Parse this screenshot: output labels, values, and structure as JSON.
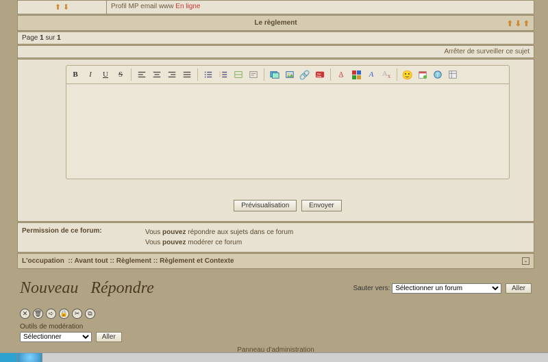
{
  "profile_row": {
    "links": "Profil MP email www",
    "status": "En ligne"
  },
  "section_title": "Le règlement",
  "pagination": {
    "label": "Page",
    "current": "1",
    "sep": "sur",
    "total": "1"
  },
  "stop_watching": "Arrêter de surveiller ce sujet",
  "editor": {
    "preview_btn": "Prévisualisation",
    "submit_btn": "Envoyer"
  },
  "permissions": {
    "label": "Permission de ce forum:",
    "line1_a": "Vous",
    "line1_b": "pouvez",
    "line1_c": "répondre aux sujets dans ce forum",
    "line2_a": "Vous",
    "line2_b": "pouvez",
    "line2_c": "modérer ce forum"
  },
  "breadcrumbs": {
    "a": "L'occupation",
    "b": "Avant tout",
    "c": "Règlement",
    "d": "Règlement et Contexte",
    "sep": "::"
  },
  "actions": {
    "new": "Nouveau",
    "reply": "Répondre"
  },
  "jump": {
    "label": "Sauter vers:",
    "placeholder": "Sélectionner un forum",
    "go": "Aller"
  },
  "moderation": {
    "label": "Outils de modération",
    "select_placeholder": "Sélectionner",
    "go": "Aller"
  },
  "admin_panel": "Panneau d'administration"
}
